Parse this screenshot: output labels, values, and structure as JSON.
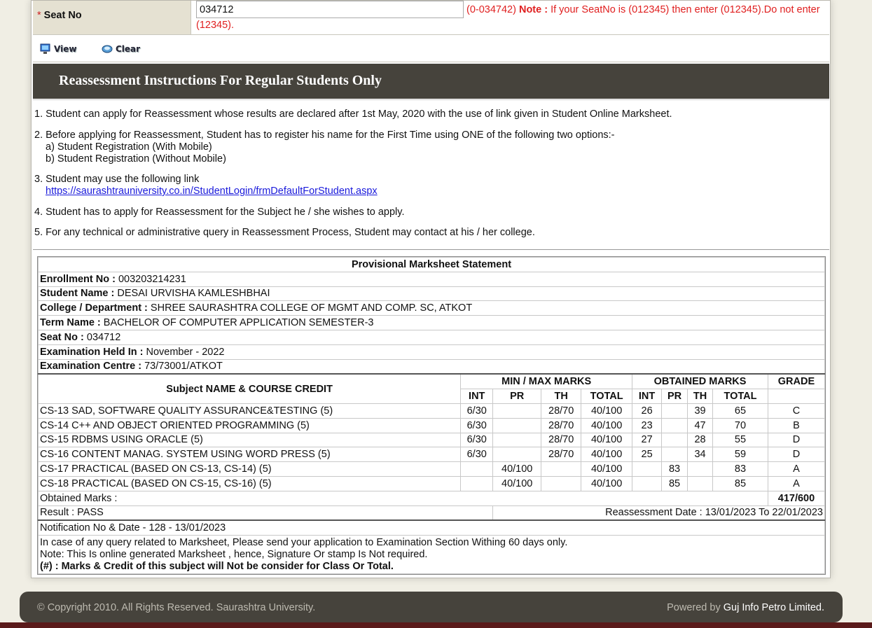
{
  "seat": {
    "label": "Seat No",
    "required_mark": "*",
    "value": "034712",
    "range": "(0-034742)",
    "note_label": "Note :",
    "note_text": "If your SeatNo is (012345) then enter (012345).Do not enter (12345)."
  },
  "buttons": {
    "view": "View",
    "clear": "Clear"
  },
  "instructions": {
    "title": "Reassessment Instructions For Regular Students Only",
    "i1": "1. Student can apply for Reassessment whose results are declared after 1st May, 2020 with the use of link given in Student Online Marksheet.",
    "i2": "2. Before applying for Reassessment, Student has to register his name for the First Time using ONE of the following two options:-",
    "i2a": "a) Student Registration (With Mobile)",
    "i2b": "b) Student Registration (Without Mobile)",
    "i3": "3. Student may use the following link",
    "i3_link": "https://saurashtrauniversity.co.in/StudentLogin/frmDefaultForStudent.aspx",
    "i4": "4. Student has to apply for Reassessment for the Subject he / she wishes to apply.",
    "i5": "5. For any technical or administrative query in Reassessment Process, Student may contact at his / her college."
  },
  "marksheet": {
    "title": "Provisional Marksheet Statement",
    "enroll_label": "Enrollment No :",
    "enroll": "003203214231",
    "name_label": "Student Name :",
    "name": "DESAI URVISHA KAMLESHBHAI",
    "college_label": "College / Department :",
    "college": "SHREE SAURASHTRA COLLEGE OF MGMT AND COMP. SC, ATKOT",
    "term_label": "Term Name :",
    "term": "BACHELOR OF COMPUTER APPLICATION SEMESTER-3",
    "seat_label": "Seat No :",
    "seat": "034712",
    "exam_label": "Examination Held In :",
    "exam": "November - 2022",
    "centre_label": "Examination Centre :",
    "centre": "73/73001/ATKOT",
    "head_subject": "Subject NAME & COURSE CREDIT",
    "head_minmax": "MIN / MAX MARKS",
    "head_obtained": "OBTAINED MARKS",
    "head_grade": "GRADE",
    "col_int": "INT",
    "col_pr": "PR",
    "col_th": "TH",
    "col_total": "TOTAL",
    "rows": [
      {
        "subject": "CS-13 SAD, SOFTWARE QUALITY ASSURANCE&TESTING (5)",
        "m_int": "6/30",
        "m_pr": "",
        "m_th": "28/70",
        "m_total": "40/100",
        "o_int": "26",
        "o_pr": "",
        "o_th": "39",
        "o_total": "65",
        "grade": "C"
      },
      {
        "subject": "CS-14 C++ AND OBJECT ORIENTED PROGRAMMING (5)",
        "m_int": "6/30",
        "m_pr": "",
        "m_th": "28/70",
        "m_total": "40/100",
        "o_int": "23",
        "o_pr": "",
        "o_th": "47",
        "o_total": "70",
        "grade": "B"
      },
      {
        "subject": "CS-15 RDBMS USING ORACLE (5)",
        "m_int": "6/30",
        "m_pr": "",
        "m_th": "28/70",
        "m_total": "40/100",
        "o_int": "27",
        "o_pr": "",
        "o_th": "28",
        "o_total": "55",
        "grade": "D"
      },
      {
        "subject": "CS-16 CONTENT MANAG. SYSTEM USING WORD PRESS (5)",
        "m_int": "6/30",
        "m_pr": "",
        "m_th": "28/70",
        "m_total": "40/100",
        "o_int": "25",
        "o_pr": "",
        "o_th": "34",
        "o_total": "59",
        "grade": "D"
      },
      {
        "subject": "CS-17 PRACTICAL (BASED ON CS-13, CS-14) (5)",
        "m_int": "",
        "m_pr": "40/100",
        "m_th": "",
        "m_total": "40/100",
        "o_int": "",
        "o_pr": "83",
        "o_th": "",
        "o_total": "83",
        "grade": "A"
      },
      {
        "subject": "CS-18 PRACTICAL (BASED ON CS-15, CS-16) (5)",
        "m_int": "",
        "m_pr": "40/100",
        "m_th": "",
        "m_total": "40/100",
        "o_int": "",
        "o_pr": "85",
        "o_th": "",
        "o_total": "85",
        "grade": "A"
      }
    ],
    "obtained_label": "Obtained Marks :",
    "obtained": "417/600",
    "result": "Result : PASS",
    "reassess": "Reassessment Date : 13/01/2023 To 22/01/2023",
    "notification": "Notification No & Date - 128 - 13/01/2023",
    "note1": "In case of any query related to Marksheet, Please send your application to Examination Section Withing 60 days only.",
    "note2": "Note: This Is online generated Marksheet , hence, Signature Or stamp Is Not required.",
    "note3": "(#) : Marks & Credit of this subject will Not be consider for Class Or Total."
  },
  "footer": {
    "copyright": "© Copyright 2010. All Rights Reserved. Saurashtra University.",
    "powered_label": "Powered by",
    "powered_company": "Guj Info Petro Limited."
  }
}
